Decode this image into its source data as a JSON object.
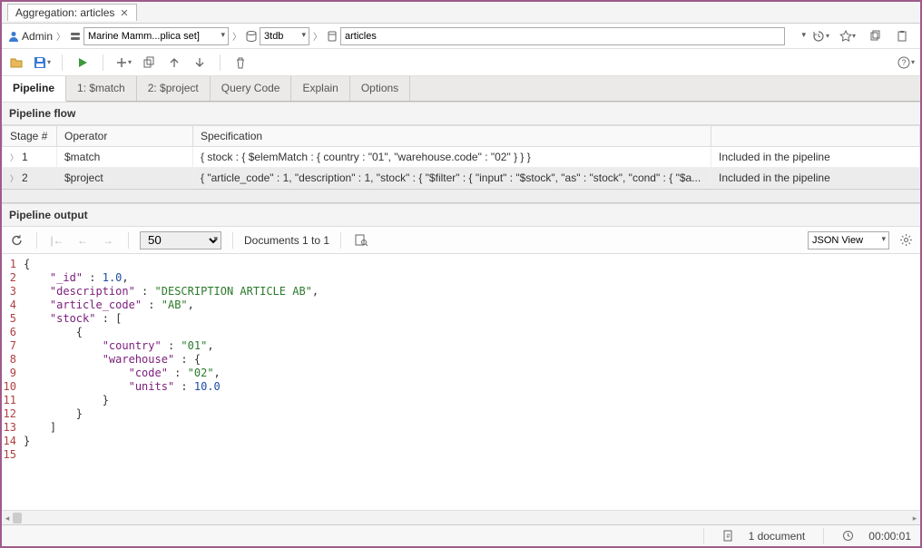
{
  "title": "Aggregation: articles",
  "breadcrumb": {
    "user": "Admin",
    "connection": "Marine Mamm...plica set]",
    "database": "3tdb",
    "collection": "articles"
  },
  "tabs": [
    "Pipeline",
    "1: $match",
    "2: $project",
    "Query Code",
    "Explain",
    "Options"
  ],
  "activeTab": 0,
  "flow": {
    "header": "Pipeline flow",
    "cols": [
      "Stage #",
      "Operator",
      "Specification",
      ""
    ],
    "rows": [
      {
        "stage": "1",
        "op": "$match",
        "spec": "{ stock : { $elemMatch : { country : \"01\", \"warehouse.code\" : \"02\" } } }",
        "status": "Included in the pipeline"
      },
      {
        "stage": "2",
        "op": "$project",
        "spec": "{ \"article_code\" : 1, \"description\" : 1, \"stock\" : { \"$filter\" : { \"input\" : \"$stock\", \"as\" : \"stock\", \"cond\" : { \"$a...",
        "status": "Included in the pipeline"
      }
    ]
  },
  "output": {
    "header": "Pipeline output",
    "page_size": "50",
    "range": "Documents 1 to 1",
    "view": "JSON View"
  },
  "code": [
    [
      [
        "p",
        "{"
      ]
    ],
    [
      [
        "p",
        "    "
      ],
      [
        "k",
        "\"_id\""
      ],
      [
        "p",
        " : "
      ],
      [
        "n",
        "1.0"
      ],
      [
        "p",
        ","
      ]
    ],
    [
      [
        "p",
        "    "
      ],
      [
        "k",
        "\"description\""
      ],
      [
        "p",
        " : "
      ],
      [
        "s",
        "\"DESCRIPTION ARTICLE AB\""
      ],
      [
        "p",
        ","
      ]
    ],
    [
      [
        "p",
        "    "
      ],
      [
        "k",
        "\"article_code\""
      ],
      [
        "p",
        " : "
      ],
      [
        "s",
        "\"AB\""
      ],
      [
        "p",
        ","
      ]
    ],
    [
      [
        "p",
        "    "
      ],
      [
        "k",
        "\"stock\""
      ],
      [
        "p",
        " : ["
      ]
    ],
    [
      [
        "p",
        "        {"
      ]
    ],
    [
      [
        "p",
        "            "
      ],
      [
        "k",
        "\"country\""
      ],
      [
        "p",
        " : "
      ],
      [
        "s",
        "\"01\""
      ],
      [
        "p",
        ","
      ]
    ],
    [
      [
        "p",
        "            "
      ],
      [
        "k",
        "\"warehouse\""
      ],
      [
        "p",
        " : {"
      ]
    ],
    [
      [
        "p",
        "                "
      ],
      [
        "k",
        "\"code\""
      ],
      [
        "p",
        " : "
      ],
      [
        "s",
        "\"02\""
      ],
      [
        "p",
        ","
      ]
    ],
    [
      [
        "p",
        "                "
      ],
      [
        "k",
        "\"units\""
      ],
      [
        "p",
        " : "
      ],
      [
        "n",
        "10.0"
      ]
    ],
    [
      [
        "p",
        "            }"
      ]
    ],
    [
      [
        "p",
        "        }"
      ]
    ],
    [
      [
        "p",
        "    ]"
      ]
    ],
    [
      [
        "p",
        "}"
      ]
    ],
    [
      [
        "p",
        ""
      ]
    ]
  ],
  "status": {
    "count": "1 document",
    "elapsed": "00:00:01"
  }
}
